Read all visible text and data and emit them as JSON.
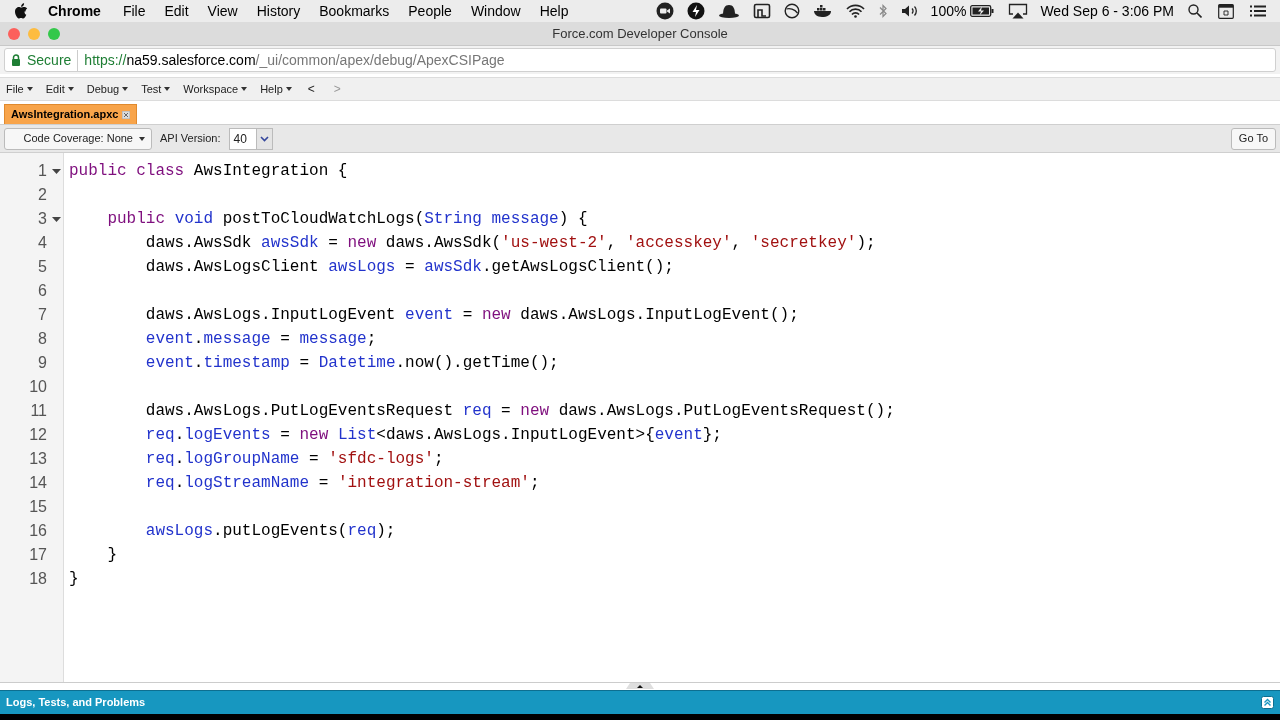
{
  "system_menu_bar": {
    "app": "Chrome",
    "menus": [
      "File",
      "Edit",
      "View",
      "History",
      "Bookmarks",
      "People",
      "Window",
      "Help"
    ],
    "battery": "100%",
    "clock": "Wed Sep 6 - 3:06 PM"
  },
  "window": {
    "title": "Force.com Developer Console"
  },
  "address_bar": {
    "secure_label": "Secure",
    "url_scheme": "https://",
    "url_host": "na59.salesforce.com",
    "url_path": "/_ui/common/apex/debug/ApexCSIPage"
  },
  "console_menu": [
    {
      "label": "File",
      "kind": "menu",
      "disabled": false
    },
    {
      "label": "Edit",
      "kind": "menu",
      "disabled": false
    },
    {
      "label": "Debug",
      "kind": "menu",
      "disabled": false
    },
    {
      "label": "Test",
      "kind": "menu",
      "disabled": false
    },
    {
      "label": "Workspace",
      "kind": "menu",
      "disabled": false
    },
    {
      "label": "Help",
      "kind": "menu",
      "disabled": false
    },
    {
      "label": "<",
      "kind": "nav",
      "disabled": false
    },
    {
      "label": ">",
      "kind": "nav",
      "disabled": true
    }
  ],
  "tabs": [
    {
      "label": "AwsIntegration.apxc",
      "selected": true
    }
  ],
  "toolbar": {
    "coverage": "Code Coverage: None",
    "api_label": "API Version:",
    "api_value": "40",
    "go_to": "Go To"
  },
  "editor": {
    "lines": [
      {
        "number": "1",
        "foldable": true,
        "tokens": [
          {
            "kind": "keyword",
            "text": "public class"
          },
          {
            "kind": "plain",
            "text": " AwsIntegration {"
          }
        ]
      },
      {
        "number": "2",
        "foldable": false
      },
      {
        "number": "3",
        "foldable": true,
        "tokens": [
          {
            "kind": "keyword",
            "text": "    public "
          },
          {
            "kind": "identifier",
            "text": "void"
          },
          {
            "kind": "plain",
            "text": " postToCloudWatchLogs("
          },
          {
            "kind": "identifier",
            "text": "String message"
          },
          {
            "kind": "plain",
            "text": ") {"
          }
        ]
      },
      {
        "number": "4",
        "foldable": false,
        "tokens": [
          {
            "kind": "plain",
            "text": "        daws.AwsSdk "
          },
          {
            "kind": "identifier",
            "text": "awsSdk"
          },
          {
            "kind": "plain",
            "text": " = "
          },
          {
            "kind": "keyword",
            "text": "new"
          },
          {
            "kind": "plain",
            "text": " daws.AwsSdk("
          },
          {
            "kind": "string",
            "text": "'us-west-2'"
          },
          {
            "kind": "plain",
            "text": ", "
          },
          {
            "kind": "string",
            "text": "'accesskey'"
          },
          {
            "kind": "plain",
            "text": ", "
          },
          {
            "kind": "string",
            "text": "'secretkey'"
          },
          {
            "kind": "plain",
            "text": ");"
          }
        ]
      },
      {
        "number": "5",
        "foldable": false,
        "tokens": [
          {
            "kind": "plain",
            "text": "        daws.AwsLogsClient "
          },
          {
            "kind": "identifier",
            "text": "awsLogs"
          },
          {
            "kind": "plain",
            "text": " = "
          },
          {
            "kind": "identifier",
            "text": "awsSdk"
          },
          {
            "kind": "plain",
            "text": ".getAwsLogsClient();"
          }
        ]
      },
      {
        "number": "6",
        "foldable": false
      },
      {
        "number": "7",
        "foldable": false,
        "tokens": [
          {
            "kind": "plain",
            "text": "        daws.AwsLogs.InputLogEvent "
          },
          {
            "kind": "identifier",
            "text": "event"
          },
          {
            "kind": "plain",
            "text": " = "
          },
          {
            "kind": "keyword",
            "text": "new"
          },
          {
            "kind": "plain",
            "text": " daws.AwsLogs.InputLogEvent();"
          }
        ]
      },
      {
        "number": "8",
        "foldable": false,
        "tokens": [
          {
            "kind": "identifier",
            "text": "        event"
          },
          {
            "kind": "plain",
            "text": "."
          },
          {
            "kind": "identifier",
            "text": "message"
          },
          {
            "kind": "plain",
            "text": " = "
          },
          {
            "kind": "identifier",
            "text": "message"
          },
          {
            "kind": "plain",
            "text": ";"
          }
        ]
      },
      {
        "number": "9",
        "foldable": false,
        "tokens": [
          {
            "kind": "identifier",
            "text": "        event"
          },
          {
            "kind": "plain",
            "text": "."
          },
          {
            "kind": "identifier",
            "text": "timestamp"
          },
          {
            "kind": "plain",
            "text": " = "
          },
          {
            "kind": "identifier",
            "text": "Datetime"
          },
          {
            "kind": "plain",
            "text": ".now().getTime();"
          }
        ]
      },
      {
        "number": "10",
        "foldable": false
      },
      {
        "number": "11",
        "foldable": false,
        "tokens": [
          {
            "kind": "plain",
            "text": "        daws.AwsLogs.PutLogEventsRequest "
          },
          {
            "kind": "identifier",
            "text": "req"
          },
          {
            "kind": "plain",
            "text": " = "
          },
          {
            "kind": "keyword",
            "text": "new"
          },
          {
            "kind": "plain",
            "text": " daws.AwsLogs.PutLogEventsRequest();"
          }
        ]
      },
      {
        "number": "12",
        "foldable": false,
        "tokens": [
          {
            "kind": "identifier",
            "text": "        req"
          },
          {
            "kind": "plain",
            "text": "."
          },
          {
            "kind": "identifier",
            "text": "logEvents"
          },
          {
            "kind": "plain",
            "text": " = "
          },
          {
            "kind": "keyword",
            "text": "new"
          },
          {
            "kind": "identifier",
            "text": " List"
          },
          {
            "kind": "plain",
            "text": "<daws.AwsLogs.InputLogEvent>{"
          },
          {
            "kind": "identifier",
            "text": "event"
          },
          {
            "kind": "plain",
            "text": "};"
          }
        ]
      },
      {
        "number": "13",
        "foldable": false,
        "tokens": [
          {
            "kind": "identifier",
            "text": "        req"
          },
          {
            "kind": "plain",
            "text": "."
          },
          {
            "kind": "identifier",
            "text": "logGroupName"
          },
          {
            "kind": "plain",
            "text": " = "
          },
          {
            "kind": "string",
            "text": "'sfdc-logs'"
          },
          {
            "kind": "plain",
            "text": ";"
          }
        ]
      },
      {
        "number": "14",
        "foldable": false,
        "tokens": [
          {
            "kind": "identifier",
            "text": "        req"
          },
          {
            "kind": "plain",
            "text": "."
          },
          {
            "kind": "identifier",
            "text": "logStreamName"
          },
          {
            "kind": "plain",
            "text": " = "
          },
          {
            "kind": "string",
            "text": "'integration-stream'"
          },
          {
            "kind": "plain",
            "text": ";"
          }
        ]
      },
      {
        "number": "15",
        "foldable": false
      },
      {
        "number": "16",
        "foldable": false,
        "tokens": [
          {
            "kind": "identifier",
            "text": "        awsLogs"
          },
          {
            "kind": "plain",
            "text": ".putLogEvents("
          },
          {
            "kind": "identifier",
            "text": "req"
          },
          {
            "kind": "plain",
            "text": ");"
          }
        ]
      },
      {
        "number": "17",
        "foldable": false,
        "tokens": [
          {
            "kind": "plain",
            "text": "    }"
          }
        ]
      },
      {
        "number": "18",
        "foldable": false,
        "tokens": [
          {
            "kind": "plain",
            "text": "}"
          }
        ]
      }
    ]
  },
  "bottom_panel": {
    "title": "Logs, Tests, and Problems"
  }
}
